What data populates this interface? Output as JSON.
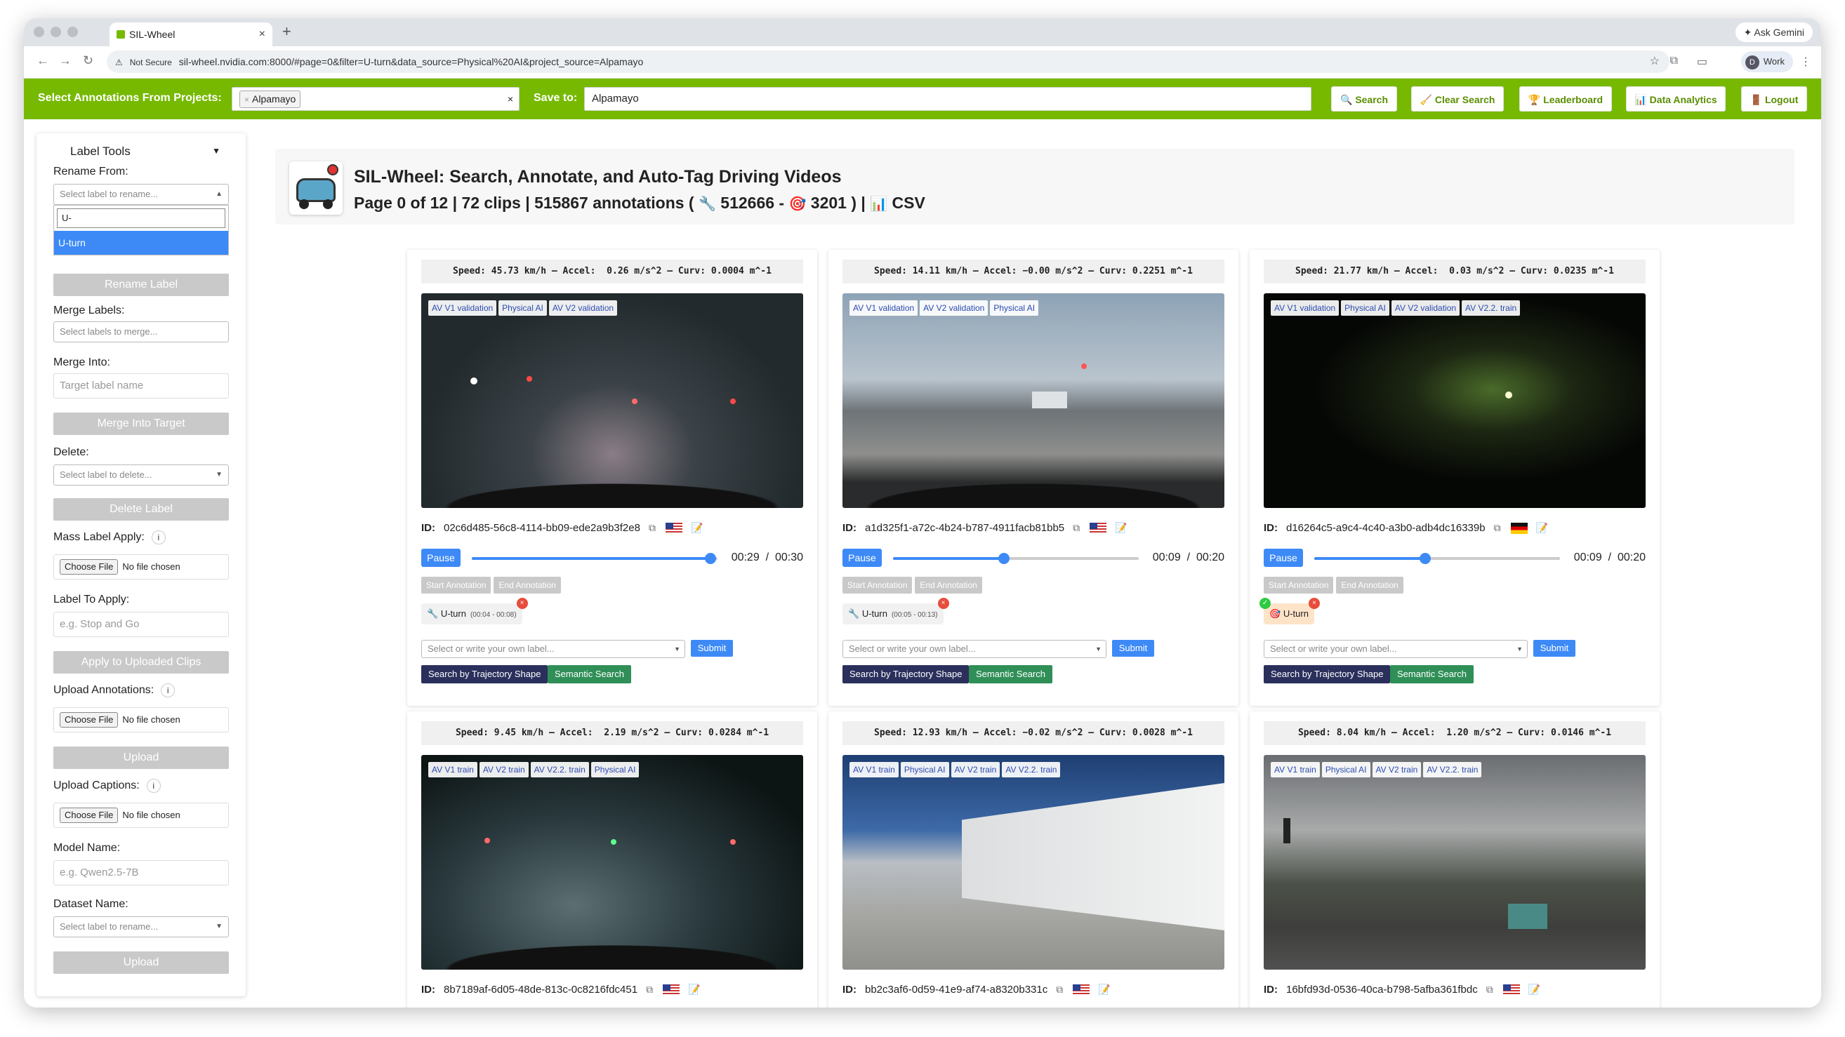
{
  "browser": {
    "tab_title": "SIL-Wheel",
    "tab_close": "×",
    "new_tab": "+",
    "ask_gemini": "Ask Gemini",
    "not_secure": "Not Secure",
    "url": "sil-wheel.nvidia.com:8000/#page=0&filter=U-turn&data_source=Physical%20AI&project_source=Alpamayo",
    "work_label": "Work",
    "work_initial": "D"
  },
  "header": {
    "select_label": "Select Annotations From Projects:",
    "project_chip": "Alpamayo",
    "chip_remove": "×",
    "clear_x": "×",
    "save_to_label": "Save to:",
    "save_to_value": "Alpamayo",
    "buttons": {
      "search": "Search",
      "clear_search": "Clear Search",
      "leaderboard": "Leaderboard",
      "data_analytics": "Data Analytics",
      "logout": "Logout"
    },
    "accent_color": "#76b900"
  },
  "sidebar": {
    "title": "Label Tools",
    "rename_from_label": "Rename From:",
    "rename_from_placeholder": "Select label to rename...",
    "rename_search_value": "U-",
    "rename_option": "U-turn",
    "rename_btn": "Rename Label",
    "merge_labels_label": "Merge Labels:",
    "merge_labels_placeholder": "Select labels to merge...",
    "merge_into_label": "Merge Into:",
    "merge_into_placeholder": "Target label name",
    "merge_btn": "Merge Into Target",
    "delete_label": "Delete:",
    "delete_placeholder": "Select label to delete...",
    "delete_btn": "Delete Label",
    "mass_apply_label": "Mass Label Apply:",
    "choose_file": "Choose File",
    "no_file": "No file chosen",
    "label_to_apply_label": "Label To Apply:",
    "label_to_apply_placeholder": "e.g. Stop and Go",
    "apply_btn": "Apply to Uploaded Clips",
    "upload_annotations_label": "Upload Annotations:",
    "upload_btn": "Upload",
    "upload_captions_label": "Upload Captions:",
    "model_name_label": "Model Name:",
    "model_name_placeholder": "e.g. Qwen2.5-7B",
    "dataset_name_label": "Dataset Name:",
    "dataset_placeholder": "Select label to rename...",
    "upload_btn2": "Upload",
    "info_glyph": "i"
  },
  "main": {
    "title": "SIL-Wheel: Search, Annotate, and Auto-Tag Driving Videos",
    "page_info": "Page 0 of 12",
    "clips": "72 clips",
    "annotations": "515867 annotations (",
    "manual_count": "512666",
    "auto_count": "3201",
    "close_paren": ")",
    "csv": "CSV",
    "sep": "|",
    "dash": "-"
  },
  "common": {
    "pause": "Pause",
    "start_annotation": "Start Annotation",
    "end_annotation": "End Annotation",
    "label_placeholder": "Select or write your own label...",
    "submit": "Submit",
    "traj_search": "Search by Trajectory Shape",
    "semantic_search": "Semantic Search",
    "id_prefix": "ID:",
    "chip_remove": "×",
    "chip_ok": "✓"
  },
  "clips": [
    {
      "stats": "Speed: 45.73 km/h – Accel:  0.26 m/s^2 – Curv: 0.0004 m^-1",
      "tags": [
        "AV V1 validation",
        "Physical AI",
        "AV V2 validation"
      ],
      "id": "02c6d485-56c8-4114-bb09-ede2a9b3f2e8",
      "flag": "us",
      "time": "00:29  /  00:30",
      "progress": 0.97,
      "label": "U-turn",
      "label_time": "(00:04 - 00:08)",
      "label_source": "manual"
    },
    {
      "stats": "Speed: 14.11 km/h – Accel: −0.00 m/s^2 – Curv: 0.2251 m^-1",
      "tags": [
        "AV V1 validation",
        "AV V2 validation",
        "Physical AI"
      ],
      "id": "a1d325f1-a72c-4b24-b787-4911facb81bb5",
      "flag": "us",
      "time": "00:09  /  00:20",
      "progress": 0.45,
      "label": "U-turn",
      "label_time": "(00:05 - 00:13)",
      "label_source": "manual"
    },
    {
      "stats": "Speed: 21.77 km/h – Accel:  0.03 m/s^2 – Curv: 0.0235 m^-1",
      "tags": [
        "AV V1 validation",
        "Physical AI",
        "AV V2 validation",
        "AV V2.2. train"
      ],
      "id": "d16264c5-a9c4-4c40-a3b0-adb4dc16339b",
      "flag": "de",
      "time": "00:09  /  00:20",
      "progress": 0.45,
      "label": "U-turn",
      "label_time": "",
      "label_source": "auto"
    },
    {
      "stats": "Speed: 9.45 km/h – Accel:  2.19 m/s^2 – Curv: 0.0284 m^-1",
      "tags": [
        "AV V1 train",
        "AV V2 train",
        "AV V2.2. train",
        "Physical AI"
      ],
      "id": "8b7189af-6d05-48de-813c-0c8216fdc451",
      "flag": "us"
    },
    {
      "stats": "Speed: 12.93 km/h – Accel: −0.02 m/s^2 – Curv: 0.0028 m^-1",
      "tags": [
        "AV V1 train",
        "Physical AI",
        "AV V2 train",
        "AV V2.2. train"
      ],
      "id": "bb2c3af6-0d59-41e9-af74-a8320b331c",
      "flag": "us"
    },
    {
      "stats": "Speed: 8.04 km/h – Accel:  1.20 m/s^2 – Curv: 0.0146 m^-1",
      "tags": [
        "AV V1 train",
        "Physical AI",
        "AV V2 train",
        "AV V2.2. train"
      ],
      "id": "16bfd93d-0536-40ca-b798-5afba361fbdc",
      "flag": "us"
    }
  ]
}
